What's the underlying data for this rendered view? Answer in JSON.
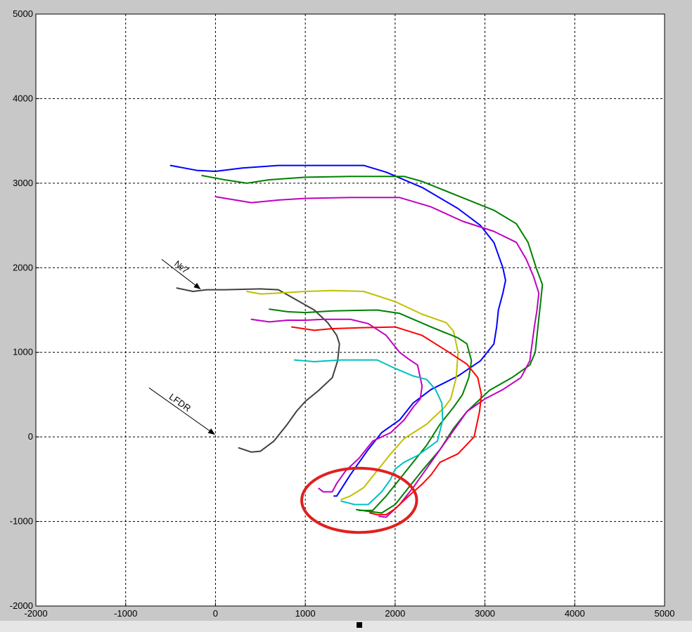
{
  "chart_data": {
    "type": "line",
    "title": "",
    "xlabel": "",
    "ylabel": "",
    "xlim": [
      -2000,
      5000
    ],
    "ylim": [
      -2000,
      5000
    ],
    "x_ticks": [
      -2000,
      -1000,
      0,
      1000,
      2000,
      3000,
      4000,
      5000
    ],
    "y_ticks": [
      -2000,
      -1000,
      0,
      1000,
      2000,
      3000,
      4000,
      5000
    ],
    "x_tick_labels": [
      "-2000",
      "-1000",
      "0",
      "1000",
      "2000",
      "3000",
      "4000",
      "5000"
    ],
    "y_tick_labels": [
      "-2000",
      "-1000",
      "0",
      "1000",
      "2000",
      "3000",
      "4000",
      "5000"
    ],
    "grid": true,
    "legend": "none",
    "annotations": [
      {
        "text": "№7",
        "from": [
          -600,
          2100
        ],
        "to": [
          -170,
          1750
        ]
      },
      {
        "text": "LFDR",
        "from": [
          -740,
          580
        ],
        "to": [
          -10,
          30
        ]
      }
    ],
    "highlight_circle": {
      "center": [
        1600,
        -750
      ],
      "rx": 640,
      "ry": 380,
      "color": "#e02020"
    },
    "series": [
      {
        "color": "#0000ff",
        "points": [
          [
            -500,
            3210
          ],
          [
            -200,
            3150
          ],
          [
            0,
            3140
          ],
          [
            300,
            3180
          ],
          [
            700,
            3210
          ],
          [
            1000,
            3210
          ],
          [
            1300,
            3210
          ],
          [
            1650,
            3210
          ],
          [
            1900,
            3130
          ],
          [
            2300,
            2950
          ],
          [
            2700,
            2700
          ],
          [
            2950,
            2500
          ],
          [
            3100,
            2300
          ],
          [
            3200,
            2000
          ],
          [
            3230,
            1850
          ],
          [
            3200,
            1700
          ],
          [
            3150,
            1500
          ],
          [
            3130,
            1300
          ],
          [
            3100,
            1100
          ],
          [
            2950,
            900
          ],
          [
            2700,
            720
          ],
          [
            2400,
            560
          ],
          [
            2200,
            400
          ],
          [
            2050,
            200
          ],
          [
            1850,
            50
          ],
          [
            1700,
            -150
          ],
          [
            1500,
            -450
          ],
          [
            1350,
            -700
          ],
          [
            1320,
            -700
          ]
        ]
      },
      {
        "color": "#008000",
        "points": [
          [
            -150,
            3090
          ],
          [
            100,
            3040
          ],
          [
            350,
            3000
          ],
          [
            600,
            3040
          ],
          [
            1000,
            3070
          ],
          [
            1500,
            3080
          ],
          [
            2100,
            3080
          ],
          [
            2300,
            3020
          ],
          [
            2700,
            2850
          ],
          [
            3100,
            2680
          ],
          [
            3350,
            2520
          ],
          [
            3480,
            2300
          ],
          [
            3570,
            2000
          ],
          [
            3640,
            1800
          ],
          [
            3620,
            1600
          ],
          [
            3600,
            1400
          ],
          [
            3560,
            1000
          ],
          [
            3500,
            850
          ],
          [
            3300,
            700
          ],
          [
            3050,
            550
          ],
          [
            2800,
            300
          ],
          [
            2650,
            100
          ],
          [
            2500,
            -150
          ],
          [
            2300,
            -400
          ],
          [
            2150,
            -600
          ],
          [
            2000,
            -800
          ],
          [
            1850,
            -900
          ],
          [
            1700,
            -880
          ],
          [
            1570,
            -860
          ]
        ]
      },
      {
        "color": "#c000c0",
        "points": [
          [
            0,
            2840
          ],
          [
            400,
            2770
          ],
          [
            700,
            2800
          ],
          [
            1000,
            2820
          ],
          [
            1500,
            2830
          ],
          [
            2050,
            2830
          ],
          [
            2400,
            2720
          ],
          [
            2750,
            2550
          ],
          [
            3100,
            2430
          ],
          [
            3350,
            2300
          ],
          [
            3460,
            2100
          ],
          [
            3540,
            1900
          ],
          [
            3600,
            1700
          ],
          [
            3580,
            1500
          ],
          [
            3550,
            1300
          ],
          [
            3500,
            900
          ],
          [
            3400,
            700
          ],
          [
            3200,
            560
          ],
          [
            3000,
            450
          ],
          [
            2800,
            300
          ],
          [
            2600,
            0
          ],
          [
            2400,
            -300
          ],
          [
            2200,
            -600
          ],
          [
            2050,
            -800
          ],
          [
            1900,
            -950
          ],
          [
            1820,
            -940
          ]
        ]
      },
      {
        "color": "#404040",
        "points": [
          [
            -430,
            1760
          ],
          [
            -250,
            1720
          ],
          [
            -100,
            1740
          ],
          [
            100,
            1740
          ],
          [
            500,
            1750
          ],
          [
            700,
            1740
          ],
          [
            850,
            1650
          ],
          [
            1100,
            1500
          ],
          [
            1250,
            1350
          ],
          [
            1350,
            1200
          ],
          [
            1380,
            1100
          ],
          [
            1360,
            900
          ],
          [
            1300,
            700
          ],
          [
            1150,
            550
          ],
          [
            1000,
            420
          ],
          [
            900,
            300
          ],
          [
            800,
            150
          ],
          [
            650,
            -50
          ],
          [
            500,
            -170
          ],
          [
            400,
            -180
          ],
          [
            260,
            -130
          ]
        ]
      },
      {
        "color": "#c0c000",
        "points": [
          [
            350,
            1720
          ],
          [
            500,
            1690
          ],
          [
            700,
            1700
          ],
          [
            1000,
            1720
          ],
          [
            1300,
            1730
          ],
          [
            1650,
            1720
          ],
          [
            2000,
            1600
          ],
          [
            2300,
            1450
          ],
          [
            2570,
            1350
          ],
          [
            2650,
            1250
          ],
          [
            2700,
            1000
          ],
          [
            2680,
            700
          ],
          [
            2620,
            450
          ],
          [
            2550,
            350
          ],
          [
            2350,
            150
          ],
          [
            2100,
            -20
          ],
          [
            1950,
            -200
          ],
          [
            1800,
            -400
          ],
          [
            1650,
            -600
          ],
          [
            1500,
            -700
          ],
          [
            1400,
            -740
          ]
        ]
      },
      {
        "color": "#008000",
        "points": [
          [
            600,
            1510
          ],
          [
            800,
            1480
          ],
          [
            1000,
            1470
          ],
          [
            1300,
            1490
          ],
          [
            1800,
            1500
          ],
          [
            2050,
            1460
          ],
          [
            2400,
            1300
          ],
          [
            2700,
            1170
          ],
          [
            2800,
            1100
          ],
          [
            2850,
            900
          ],
          [
            2820,
            700
          ],
          [
            2750,
            500
          ],
          [
            2650,
            350
          ],
          [
            2500,
            150
          ],
          [
            2350,
            -100
          ],
          [
            2200,
            -300
          ],
          [
            2050,
            -500
          ],
          [
            1900,
            -700
          ],
          [
            1750,
            -870
          ],
          [
            1600,
            -870
          ]
        ]
      },
      {
        "color": "#c000c0",
        "points": [
          [
            400,
            1390
          ],
          [
            600,
            1360
          ],
          [
            800,
            1380
          ],
          [
            1000,
            1380
          ],
          [
            1200,
            1390
          ],
          [
            1500,
            1390
          ],
          [
            1700,
            1340
          ],
          [
            1900,
            1200
          ],
          [
            2050,
            1000
          ],
          [
            2150,
            920
          ],
          [
            2250,
            850
          ],
          [
            2300,
            600
          ],
          [
            2280,
            450
          ],
          [
            2200,
            350
          ],
          [
            2100,
            200
          ],
          [
            1950,
            50
          ],
          [
            1750,
            -50
          ],
          [
            1600,
            -250
          ],
          [
            1450,
            -400
          ],
          [
            1350,
            -550
          ],
          [
            1300,
            -650
          ],
          [
            1200,
            -650
          ],
          [
            1150,
            -610
          ]
        ]
      },
      {
        "color": "#ff0000",
        "points": [
          [
            850,
            1300
          ],
          [
            1100,
            1260
          ],
          [
            1300,
            1280
          ],
          [
            1600,
            1290
          ],
          [
            2000,
            1300
          ],
          [
            2300,
            1200
          ],
          [
            2600,
            1000
          ],
          [
            2800,
            860
          ],
          [
            2920,
            700
          ],
          [
            2960,
            500
          ],
          [
            2940,
            300
          ],
          [
            2880,
            0
          ],
          [
            2700,
            -200
          ],
          [
            2500,
            -300
          ],
          [
            2400,
            -450
          ],
          [
            2300,
            -560
          ],
          [
            2150,
            -700
          ],
          [
            2000,
            -850
          ],
          [
            1900,
            -920
          ],
          [
            1800,
            -920
          ],
          [
            1720,
            -900
          ]
        ]
      },
      {
        "color": "#00c0c0",
        "points": [
          [
            880,
            910
          ],
          [
            1100,
            890
          ],
          [
            1400,
            910
          ],
          [
            1800,
            910
          ],
          [
            2000,
            810
          ],
          [
            2200,
            720
          ],
          [
            2350,
            680
          ],
          [
            2450,
            560
          ],
          [
            2520,
            400
          ],
          [
            2530,
            200
          ],
          [
            2470,
            -50
          ],
          [
            2250,
            -220
          ],
          [
            2100,
            -300
          ],
          [
            2000,
            -380
          ],
          [
            1950,
            -500
          ],
          [
            1850,
            -650
          ],
          [
            1700,
            -800
          ],
          [
            1550,
            -800
          ],
          [
            1400,
            -760
          ]
        ]
      }
    ]
  },
  "colors": {
    "background": "#c8c8c8",
    "plot_background": "#ffffff",
    "grid": "#000000"
  }
}
